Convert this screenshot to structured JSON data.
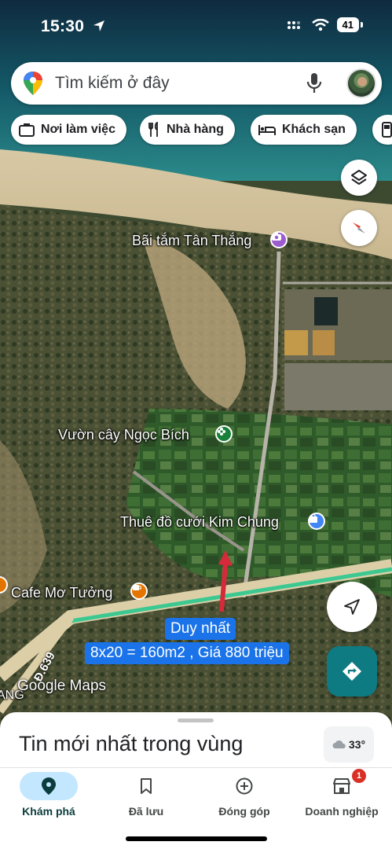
{
  "status_bar": {
    "time": "15:30",
    "battery": "41"
  },
  "search": {
    "placeholder": "Tìm kiếm ở đây"
  },
  "chips": [
    {
      "label": "Nơi làm việc",
      "icon": "briefcase-icon"
    },
    {
      "label": "Nhà hàng",
      "icon": "fork-knife-icon"
    },
    {
      "label": "Khách sạn",
      "icon": "bed-icon"
    }
  ],
  "map": {
    "places": [
      {
        "label": "Bãi tắm Tân Thắng",
        "icon": "camera-icon",
        "color": "#9c5ccf"
      },
      {
        "label": "Vườn cây Ngọc Bích",
        "icon": "flower-icon",
        "color": "#188038"
      },
      {
        "label": "Thuê đồ cưới Kim Chung",
        "icon": "shopping-bag-icon",
        "color": "#4285f4"
      },
      {
        "label": "Cafe Mơ Tưởng",
        "icon": "coffee-cup-icon",
        "color": "#e37400"
      }
    ],
    "road_label": "Đ.639",
    "edge_label": "ANG",
    "attribution": "Google Maps"
  },
  "annotations": {
    "line1": "Duy nhất",
    "line2": "8x20 = 160m2 , Giá 880 triệu"
  },
  "sheet": {
    "title": "Tin mới nhất trong vùng",
    "weather": "33°"
  },
  "bottom_nav": [
    {
      "label": "Khám phá",
      "icon": "location-pin-icon",
      "active": true
    },
    {
      "label": "Đã lưu",
      "icon": "bookmark-icon",
      "active": false
    },
    {
      "label": "Đóng góp",
      "icon": "add-circle-icon",
      "active": false
    },
    {
      "label": "Doanh nghiệp",
      "icon": "storefront-icon",
      "active": false,
      "badge": "1"
    }
  ],
  "colors": {
    "accent": "#1a73e8",
    "route": "#3cc891",
    "arrow": "#d62a3a",
    "directions_button": "#0e7b82"
  }
}
